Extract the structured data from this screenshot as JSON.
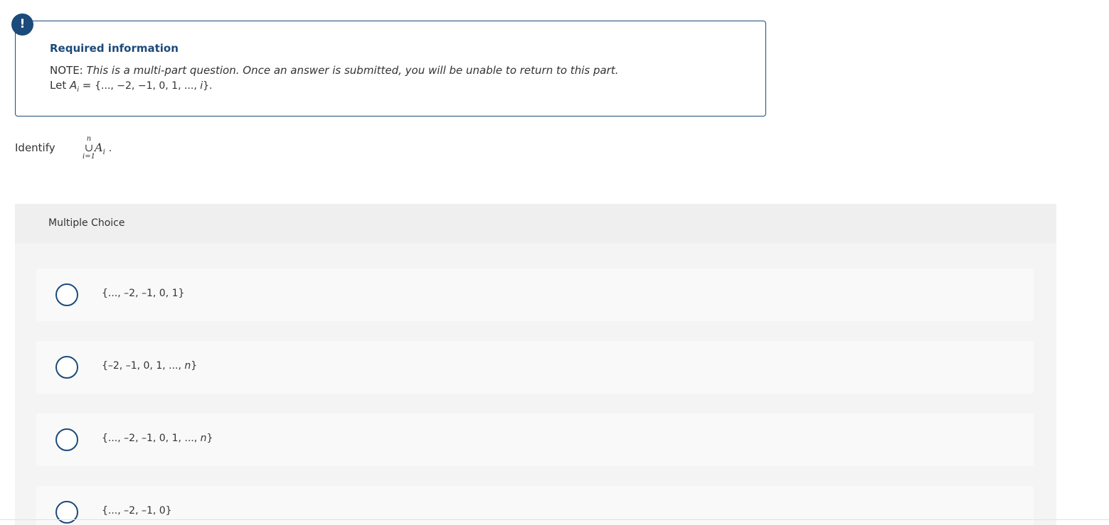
{
  "info": {
    "badge": "!",
    "title": "Required information",
    "note_label": "NOTE:",
    "note_text": "This is a multi-part question. Once an answer is submitted, you will be unable to return to this part.",
    "let_prefix": "Let ",
    "let_var": "A",
    "let_sub": "i",
    "let_eq": " = ",
    "let_set": "{..., −2, −1, 0, 1, ..., ",
    "let_set_var": "i",
    "let_set_end": "}."
  },
  "question": {
    "prompt": "Identify",
    "union_upper": "n",
    "union_symbol": "∪",
    "union_lower": "i=1",
    "term_var": "A",
    "term_sub": "i",
    "term_end": "."
  },
  "multiple_choice": {
    "header": "Multiple Choice",
    "options": [
      {
        "text": "{..., –2, –1, 0, 1}",
        "var": "",
        "end": ""
      },
      {
        "text": "{–2, –1, 0, 1, ..., ",
        "var": "n",
        "end": "}"
      },
      {
        "text": "{..., –2, –1, 0, 1, ..., ",
        "var": "n",
        "end": "}"
      },
      {
        "text": "{..., –2, –1, 0}",
        "var": "",
        "end": ""
      }
    ]
  },
  "colors": {
    "accent": "#1c4a7a",
    "panel": "#f2f2f2",
    "option_bg": "#f9f9f9"
  }
}
